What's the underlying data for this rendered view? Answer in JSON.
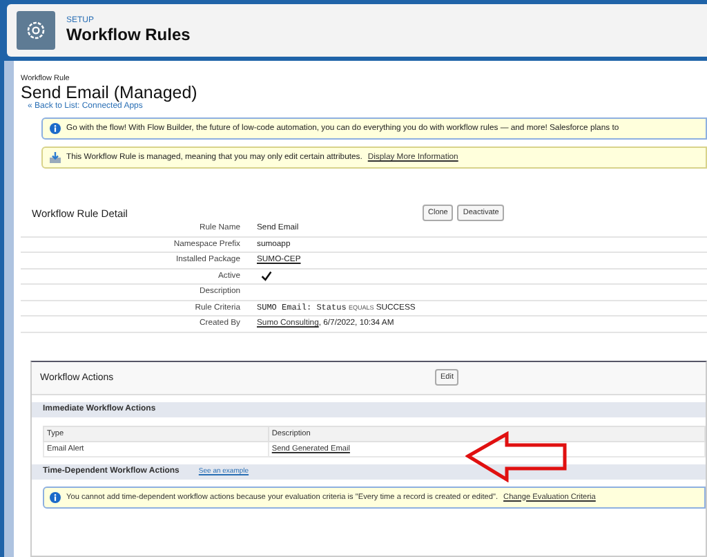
{
  "header": {
    "section": "SETUP",
    "title": "Workflow Rules"
  },
  "page": {
    "type_label": "Workflow Rule",
    "title": "Send Email (Managed)",
    "back_link": "« Back to List: Connected Apps"
  },
  "banners": [
    {
      "kind": "info",
      "text": "Go with the flow! With Flow Builder, the future of low-code automation, you can do everything you do with workflow rules — and more! Salesforce plans to"
    },
    {
      "kind": "managed",
      "text": "This Workflow Rule is managed, meaning that you may only edit certain attributes.",
      "link": "Display More Information"
    }
  ],
  "detail": {
    "title": "Workflow Rule Detail",
    "buttons": [
      "Clone",
      "Deactivate"
    ],
    "fields": [
      {
        "label": "Rule Name",
        "kind": "text",
        "value": "Send Email"
      },
      {
        "label": "Namespace Prefix",
        "kind": "text",
        "value": "sumoapp"
      },
      {
        "label": "Installed Package",
        "kind": "link",
        "value": "SUMO-CEP"
      },
      {
        "label": "Active",
        "kind": "checkbox",
        "checked": true
      },
      {
        "label": "Description",
        "kind": "text"
      },
      {
        "label": "Rule Criteria",
        "kind": "criteria",
        "field": "SUMO Email: Status",
        "operator": "EQUALS",
        "value": "SUCCESS"
      },
      {
        "label": "Created By",
        "kind": "link_text",
        "link": "Sumo Consulting",
        "value": ", 6/7/2022, 10:34 AM"
      }
    ]
  },
  "actions": {
    "title": "Workflow Actions",
    "buttons": [
      "Edit"
    ],
    "immediate": {
      "title": "Immediate Workflow Actions",
      "columns": [
        "Type",
        "Description"
      ],
      "rows": [
        [
          "Email Alert",
          "Send Generated Email"
        ]
      ]
    },
    "time_dependent": {
      "title": "Time-Dependent Workflow Actions",
      "link": "See an example",
      "notice": {
        "text": "You cannot add time-dependent workflow actions because your evaluation criteria is \"Every time a record is created or edited\".",
        "link": "Change Evaluation Criteria"
      }
    }
  }
}
